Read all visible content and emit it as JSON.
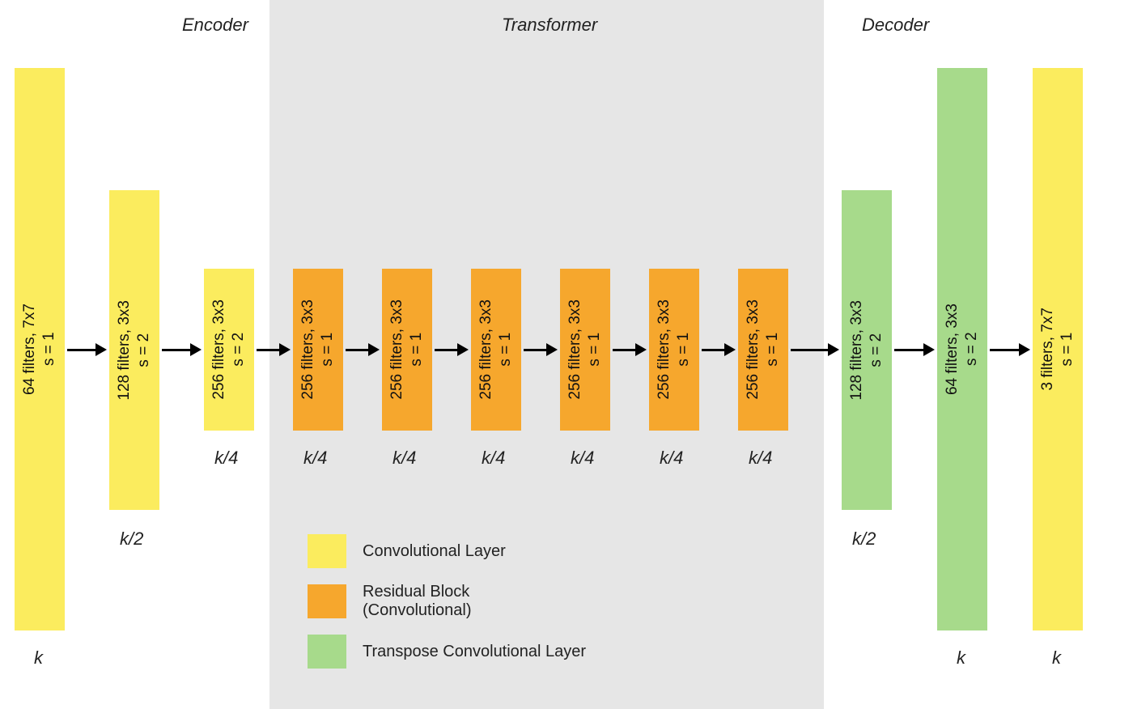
{
  "sections": {
    "encoder": "Encoder",
    "transformer": "Transformer",
    "decoder": "Decoder"
  },
  "layers": [
    {
      "id": "enc1",
      "kind": "conv",
      "text": "64 filters, 7x7\ns = 1",
      "below": "k",
      "height": "full"
    },
    {
      "id": "enc2",
      "kind": "conv",
      "text": "128 filters, 3x3\ns = 2",
      "below": "k/2",
      "height": "half"
    },
    {
      "id": "enc3",
      "kind": "conv",
      "text": "256 filters, 3x3\ns = 2",
      "below": "k/4",
      "height": "quarter"
    },
    {
      "id": "res1",
      "kind": "res",
      "text": "256 filters, 3x3\ns = 1",
      "below": "k/4",
      "height": "quarter"
    },
    {
      "id": "res2",
      "kind": "res",
      "text": "256 filters, 3x3\ns = 1",
      "below": "k/4",
      "height": "quarter"
    },
    {
      "id": "res3",
      "kind": "res",
      "text": "256 filters, 3x3\ns = 1",
      "below": "k/4",
      "height": "quarter"
    },
    {
      "id": "res4",
      "kind": "res",
      "text": "256 filters, 3x3\ns = 1",
      "below": "k/4",
      "height": "quarter"
    },
    {
      "id": "res5",
      "kind": "res",
      "text": "256 filters, 3x3\ns = 1",
      "below": "k/4",
      "height": "quarter"
    },
    {
      "id": "res6",
      "kind": "res",
      "text": "256 filters, 3x3\ns = 1",
      "below": "k/4",
      "height": "quarter"
    },
    {
      "id": "dec1",
      "kind": "tconv",
      "text": "128 filters, 3x3\ns = 2",
      "below": "k/2",
      "height": "half"
    },
    {
      "id": "dec2",
      "kind": "tconv",
      "text": "64 filters, 3x3\ns = 2",
      "below": "k",
      "height": "full"
    },
    {
      "id": "dec3",
      "kind": "conv",
      "text": "3 filters, 7x7\ns = 1",
      "below": "k",
      "height": "full"
    }
  ],
  "legend": {
    "conv": "Convolutional Layer",
    "res": "Residual Block\n(Convolutional)",
    "tconv": "Transpose Convolutional Layer"
  },
  "colors": {
    "conv": "#fbec5e",
    "res": "#f6a72d",
    "tconv": "#a7da8b"
  }
}
